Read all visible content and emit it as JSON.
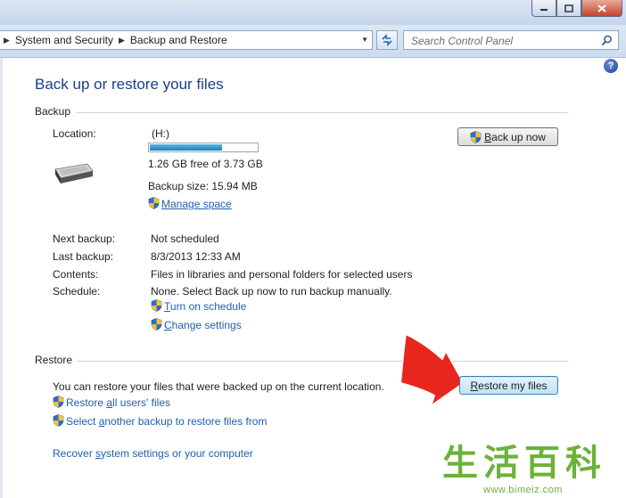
{
  "breadcrumb": [
    "System and Security",
    "Backup and Restore"
  ],
  "search": {
    "placeholder": "Search Control Panel"
  },
  "help_label": "?",
  "page_title": "Back up or restore your files",
  "backup": {
    "heading": "Backup",
    "location_label": "Location:",
    "drive": "(H:)",
    "used_fraction": 0.66,
    "free_text": "1.26 GB free of 3.73 GB",
    "size_text": "Backup size: 15.94 MB",
    "manage_space": {
      "prefix": "",
      "underline": "M",
      "rest": "anage space"
    },
    "back_up_now": {
      "underline": "B",
      "rest": "ack up now"
    },
    "details": [
      {
        "label": "Next backup:",
        "value": "Not scheduled"
      },
      {
        "label": "Last backup:",
        "value": "8/3/2013 12:33 AM"
      },
      {
        "label": "Contents:",
        "value": "Files in libraries and personal folders for selected users"
      },
      {
        "label": "Schedule:",
        "value": "None. Select Back up now to run backup manually."
      }
    ],
    "turn_on_schedule": {
      "underline": "T",
      "rest": "urn on schedule"
    },
    "change_settings": {
      "underline": "C",
      "rest": "hange settings"
    }
  },
  "restore": {
    "heading": "Restore",
    "info": "You can restore your files that were backed up on the current location.",
    "restore_my_files": {
      "prefix": "",
      "underline": "R",
      "rest": "estore my files"
    },
    "restore_all": {
      "prefix": "Restore ",
      "underline": "a",
      "rest": "ll users' files"
    },
    "select_another": {
      "prefix": "Select ",
      "underline": "a",
      "rest": "nother backup to restore files from"
    },
    "recover": {
      "prefix": "Recover ",
      "underline": "s",
      "rest": "ystem settings or your computer"
    }
  },
  "watermark": {
    "chars": [
      "生",
      "活",
      "百",
      "科"
    ],
    "url": "www.bimeiz.com"
  },
  "colors": {
    "link": "#1f5fad",
    "title": "#1a3e8c",
    "arrow": "#e8261d",
    "watermark": "#6cb23a"
  }
}
